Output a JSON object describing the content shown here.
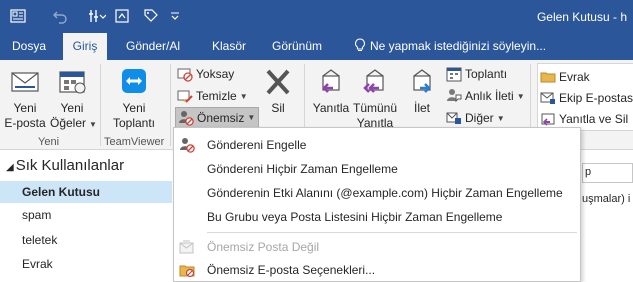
{
  "titlebar": {
    "title": "Gelen Kutusu - h",
    "qat_icons": [
      "mailbox-icon",
      "undo-icon",
      "customize-qat-icon",
      "qat-box-icon",
      "qat-tag-icon",
      "qat-dropdown-icon"
    ]
  },
  "tabs": [
    {
      "label": "Dosya",
      "active": false
    },
    {
      "label": "Giriş",
      "active": true
    },
    {
      "label": "Gönder/Al",
      "active": false
    },
    {
      "label": "Klasör",
      "active": false
    },
    {
      "label": "Görünüm",
      "active": false
    },
    {
      "label": "Ne yapmak istediğinizi söyleyin...",
      "active": false
    }
  ],
  "ribbon": {
    "yeni": {
      "new_email": [
        "Yeni",
        "E-posta"
      ],
      "new_items": [
        "Yeni",
        "Öğeler"
      ],
      "group_label": "Yeni"
    },
    "teamviewer": {
      "new_meeting": [
        "Yeni",
        "Toplantı"
      ],
      "group_label": "TeamViewer"
    },
    "sil": {
      "ignore": "Yoksay",
      "clean": "Temizle",
      "junk": "Önemsiz",
      "delete": "Sil"
    },
    "respond": {
      "reply": "Yanıtla",
      "reply_all": [
        "Tümünü",
        "Yanıtla"
      ],
      "forward": "İlet",
      "meeting": "Toplantı",
      "im": "Anlık İleti",
      "more": "Diğer"
    },
    "quick_steps": {
      "items": [
        "Evrak",
        "Ekip E-postas",
        "Yanıtla ve Sil"
      ]
    }
  },
  "sidebar": {
    "favorites_header": "Sık Kullanılanlar",
    "folders": [
      "Gelen Kutusu",
      "spam",
      "teletek",
      "Evrak"
    ],
    "selected": "Gelen Kutusu"
  },
  "background_fragments": {
    "search_fragment": "p",
    "message_fragment": "uşmalar) i"
  },
  "junk_menu": {
    "items": [
      {
        "label": "Göndereni Engelle",
        "icon": "block-sender-icon",
        "enabled": true
      },
      {
        "label": "Göndereni Hiçbir Zaman Engelleme",
        "icon": "",
        "enabled": true
      },
      {
        "label": "Gönderenin Etki Alanını (@example.com) Hiçbir Zaman Engelleme",
        "icon": "",
        "enabled": true
      },
      {
        "label": "Bu Grubu veya Posta Listesini Hiçbir Zaman Engelleme",
        "icon": "",
        "enabled": true
      },
      {
        "label": "Önemsiz Posta Değil",
        "icon": "not-junk-icon",
        "enabled": false
      },
      {
        "label": "Önemsiz E-posta Seçenekleri...",
        "icon": "junk-options-icon",
        "enabled": true
      }
    ]
  },
  "colors": {
    "brand_blue": "#2b579a",
    "ribbon_bg": "#f3f3f3",
    "selected_folder": "#cde6f7",
    "disabled_text": "#a6a6a6"
  }
}
